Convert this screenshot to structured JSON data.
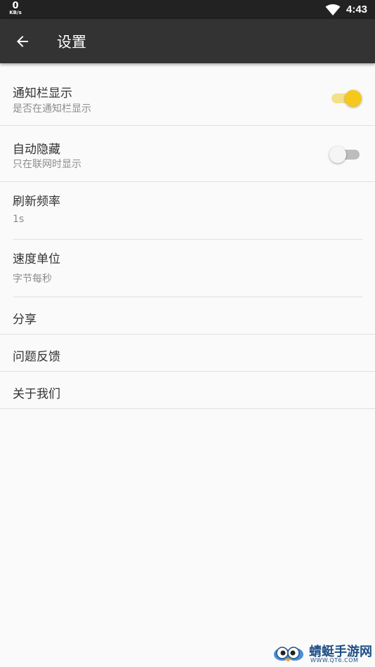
{
  "status_bar": {
    "net_speed_value": "0",
    "net_speed_unit": "KB/s",
    "time": "4:43",
    "wifi_icon": "wifi-full-icon"
  },
  "toolbar": {
    "back_icon": "arrow-left-icon",
    "title": "设置"
  },
  "settings": {
    "notification_bar": {
      "title": "通知栏显示",
      "subtitle": "是否在通知栏显示",
      "enabled": true
    },
    "auto_hide": {
      "title": "自动隐藏",
      "subtitle": "只在联网时显示",
      "enabled": false
    },
    "refresh_rate": {
      "title": "刷新频率",
      "value": "1s"
    },
    "speed_unit": {
      "title": "速度单位",
      "value": "字节每秒"
    },
    "share": {
      "title": "分享"
    },
    "feedback": {
      "title": "问题反馈"
    },
    "about": {
      "title": "关于我们"
    }
  },
  "colors": {
    "accent": "#f6c81b",
    "toolbar": "#333333",
    "status_bar": "#222222",
    "background": "#fafafa"
  },
  "watermark": {
    "name": "蜻蜓手游网",
    "url": "WWW.QT6.COM"
  }
}
